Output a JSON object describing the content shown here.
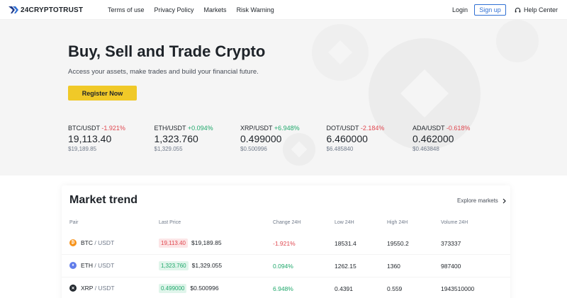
{
  "nav": {
    "logo_text": "24CRYPTOTRUST",
    "links": [
      "Terms of use",
      "Privacy Policy",
      "Markets",
      "Risk Warning"
    ],
    "login": "Login",
    "signup": "Sign up",
    "help": "Help Center"
  },
  "hero": {
    "title": "Buy, Sell and Trade Crypto",
    "subtitle": "Access your assets, make trades and build your financial future.",
    "register_label": "Register Now"
  },
  "tickers": [
    {
      "pair": "BTC/USDT",
      "change": "-1.921%",
      "direction": "down",
      "price": "19,113.40",
      "usd": "$19,189.85"
    },
    {
      "pair": "ETH/USDT",
      "change": "+0.094%",
      "direction": "up",
      "price": "1,323.760",
      "usd": "$1,329.055"
    },
    {
      "pair": "XRP/USDT",
      "change": "+6.948%",
      "direction": "up",
      "price": "0.499000",
      "usd": "$0.500996"
    },
    {
      "pair": "DOT/USDT",
      "change": "-2.184%",
      "direction": "down",
      "price": "6.460000",
      "usd": "$6.485840"
    },
    {
      "pair": "ADA/USDT",
      "change": "-0.618%",
      "direction": "down",
      "price": "0.462000",
      "usd": "$0.463848"
    }
  ],
  "market": {
    "title": "Market trend",
    "explore": "Explore markets",
    "columns": {
      "pair": "Pair",
      "last": "Last Price",
      "change": "Change 24H",
      "low": "Low 24H",
      "high": "High 24H",
      "volume": "Volume 24H"
    },
    "rows": [
      {
        "base": "BTC",
        "quote": "USDT",
        "icon": "bitcoin-icon",
        "icon_color": "#f7931a",
        "glyph": "₿",
        "last": "19,113.40",
        "last_usd": "$19,189.85",
        "direction": "down",
        "change": "-1.921%",
        "low": "18531.4",
        "high": "19550.2",
        "volume": "373337"
      },
      {
        "base": "ETH",
        "quote": "USDT",
        "icon": "ethereum-icon",
        "icon_color": "#627eea",
        "glyph": "♦",
        "last": "1,323.760",
        "last_usd": "$1,329.055",
        "direction": "up",
        "change": "0.094%",
        "low": "1262.15",
        "high": "1360",
        "volume": "987400"
      },
      {
        "base": "XRP",
        "quote": "USDT",
        "icon": "xrp-icon",
        "icon_color": "#23292f",
        "glyph": "✕",
        "last": "0.499000",
        "last_usd": "$0.500996",
        "direction": "up",
        "change": "6.948%",
        "low": "0.4391",
        "high": "0.559",
        "volume": "1943510000"
      }
    ]
  },
  "colors": {
    "accent_yellow": "#f0c928",
    "up_green": "#1fa86b",
    "down_red": "#e0474f",
    "link_blue": "#2f6fd3"
  }
}
